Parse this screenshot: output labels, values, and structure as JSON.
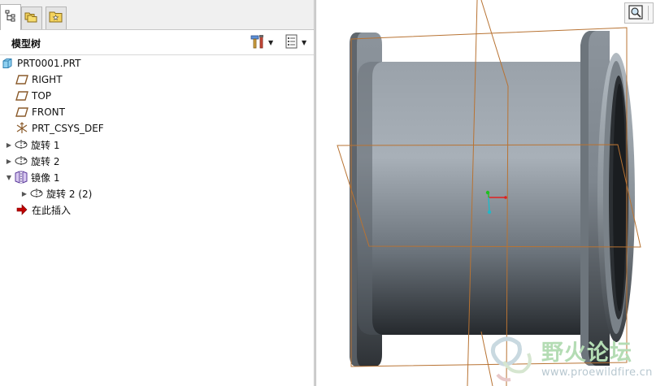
{
  "tabs": [
    {
      "name": "model-tree",
      "icon": "model-tree-tab-icon",
      "active": true
    },
    {
      "name": "folder-browser",
      "icon": "folder-browser-tab-icon",
      "active": false
    },
    {
      "name": "favorites",
      "icon": "favorites-tab-icon",
      "active": false
    }
  ],
  "header": {
    "title": "模型树",
    "settings_icon": "tools-settings-icon",
    "show_icon": "tree-show-options-icon"
  },
  "tree": {
    "root": {
      "label": "PRT0001.PRT",
      "icon": "part-icon"
    },
    "items": [
      {
        "label": "RIGHT",
        "icon": "datum-plane-icon",
        "level": 1,
        "expand": ""
      },
      {
        "label": "TOP",
        "icon": "datum-plane-icon",
        "level": 1,
        "expand": ""
      },
      {
        "label": "FRONT",
        "icon": "datum-plane-icon",
        "level": 1,
        "expand": ""
      },
      {
        "label": "PRT_CSYS_DEF",
        "icon": "coordinate-system-icon",
        "level": 1,
        "expand": ""
      },
      {
        "label": "旋转 1",
        "icon": "revolve-feature-icon",
        "level": 1,
        "expand": "collapsed"
      },
      {
        "label": "旋转 2",
        "icon": "revolve-feature-icon",
        "level": 1,
        "expand": "collapsed"
      },
      {
        "label": "镜像 1",
        "icon": "mirror-feature-icon",
        "level": 1,
        "expand": "expanded"
      },
      {
        "label": "旋转 2 (2)",
        "icon": "revolve-feature-icon",
        "level": 2,
        "expand": "collapsed"
      },
      {
        "label": "在此插入",
        "icon": "insert-here-arrow-icon",
        "level": 1,
        "expand": ""
      }
    ]
  },
  "graphics": {
    "view_button_icon": "zoom-view-icon"
  },
  "watermark": {
    "title": "野火论坛",
    "url": "www.proewildfire.cn"
  },
  "colors": {
    "datum_plane": "#b87333",
    "insert_arrow": "#c00000",
    "csys_x": "#e02020",
    "csys_y": "#20c020",
    "csys_z": "#20b8c8",
    "part_icon": "#5ab4e6"
  }
}
